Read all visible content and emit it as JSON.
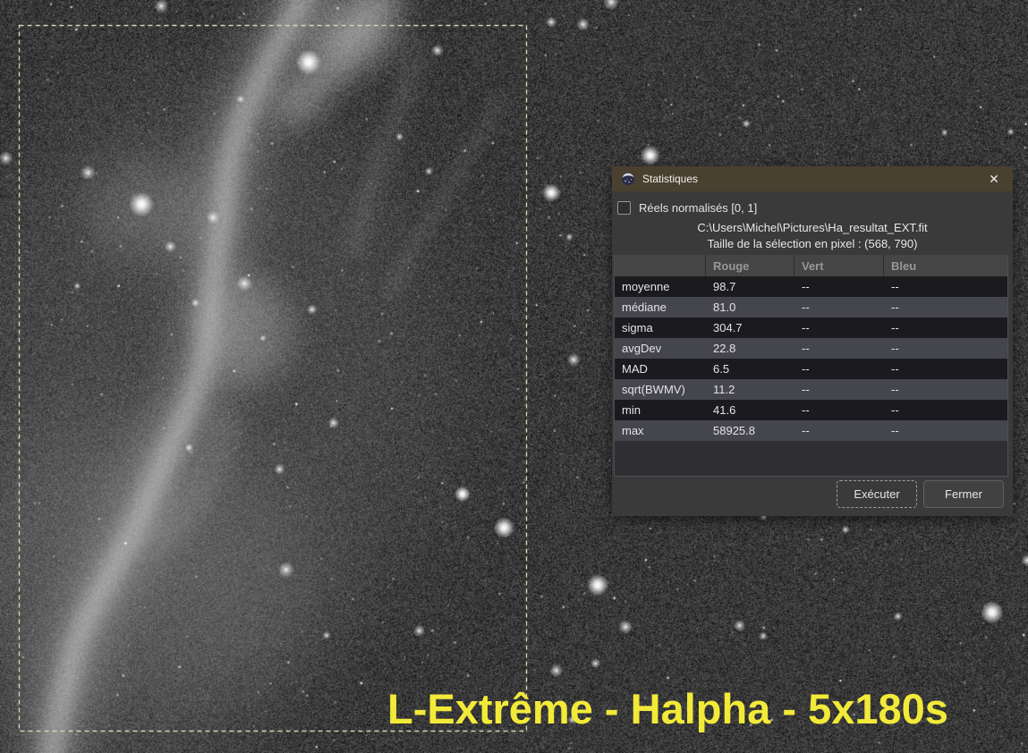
{
  "caption": "L-Extrême - Halpha - 5x180s",
  "dialog": {
    "title": "Statistiques",
    "close_icon": "✕",
    "normalized_checkbox": {
      "label": "Réels normalisés [0, 1]",
      "checked": false
    },
    "file_path": "C:\\Users\\Michel\\Pictures\\Ha_resultat_EXT.fit",
    "selection_size_text": "Taille de la sélection en pixel : (568, 790)",
    "table": {
      "columns": [
        "",
        "Rouge",
        "Vert",
        "Bleu"
      ],
      "rows": [
        {
          "stat": "moyenne",
          "rouge": "98.7",
          "vert": "--",
          "bleu": "--"
        },
        {
          "stat": "médiane",
          "rouge": "81.0",
          "vert": "--",
          "bleu": "--"
        },
        {
          "stat": "sigma",
          "rouge": "304.7",
          "vert": "--",
          "bleu": "--"
        },
        {
          "stat": "avgDev",
          "rouge": "22.8",
          "vert": "--",
          "bleu": "--"
        },
        {
          "stat": "MAD",
          "rouge": "6.5",
          "vert": "--",
          "bleu": "--"
        },
        {
          "stat": "sqrt(BWMV)",
          "rouge": "11.2",
          "vert": "--",
          "bleu": "--"
        },
        {
          "stat": "min",
          "rouge": "41.6",
          "vert": "--",
          "bleu": "--"
        },
        {
          "stat": "max",
          "rouge": "58925.8",
          "vert": "--",
          "bleu": "--"
        }
      ]
    },
    "buttons": {
      "execute": "Exécuter",
      "close": "Fermer"
    }
  },
  "colors": {
    "titlebar": "#4a402f",
    "dialog_bg": "#3a3a3a",
    "row_dark": "#1b1b1f",
    "row_light": "#45454e",
    "caption_yellow": "#f2ea39",
    "selection_border": "#ccd8ae"
  }
}
